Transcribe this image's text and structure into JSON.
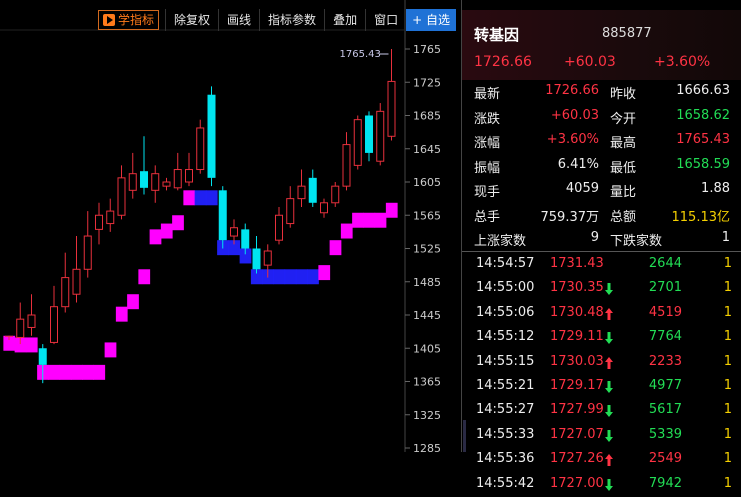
{
  "toolbar": {
    "learn": "学指标",
    "items": [
      "除复权",
      "画线",
      "指标参数",
      "叠加",
      "窗口"
    ],
    "fav": "+ 自选"
  },
  "chart_data": {
    "type": "candlestick",
    "y_axis_labels": [
      "1765",
      "1725",
      "1685",
      "1645",
      "1605",
      "1565",
      "1525",
      "1485",
      "1445",
      "1405",
      "1365",
      "1325",
      "1285"
    ],
    "high_annotation": "1765.43",
    "ylim": [
      1285,
      1770
    ],
    "colors": {
      "up": "#e8303c",
      "down": "#00e5f0",
      "band_up": "#ff00ff",
      "band_down": "#0000ff"
    },
    "candles": [
      {
        "o": 1420,
        "c": 1420,
        "h": 1420,
        "l": 1415,
        "color": "up",
        "hollow": false
      },
      {
        "o": 1418,
        "c": 1440,
        "h": 1460,
        "l": 1410,
        "color": "up",
        "hollow": true
      },
      {
        "o": 1430,
        "c": 1445,
        "h": 1470,
        "l": 1420,
        "color": "up",
        "hollow": true
      },
      {
        "o": 1405,
        "c": 1385,
        "h": 1410,
        "l": 1363,
        "color": "down",
        "hollow": false
      },
      {
        "o": 1412,
        "c": 1455,
        "h": 1480,
        "l": 1410,
        "color": "up",
        "hollow": true
      },
      {
        "o": 1455,
        "c": 1490,
        "h": 1520,
        "l": 1448,
        "color": "up",
        "hollow": true
      },
      {
        "o": 1470,
        "c": 1500,
        "h": 1540,
        "l": 1460,
        "color": "up",
        "hollow": true
      },
      {
        "o": 1500,
        "c": 1540,
        "h": 1570,
        "l": 1490,
        "color": "up",
        "hollow": true
      },
      {
        "o": 1548,
        "c": 1565,
        "h": 1580,
        "l": 1530,
        "color": "up",
        "hollow": true
      },
      {
        "o": 1555,
        "c": 1570,
        "h": 1585,
        "l": 1545,
        "color": "up",
        "hollow": true
      },
      {
        "o": 1565,
        "c": 1610,
        "h": 1625,
        "l": 1560,
        "color": "up",
        "hollow": true
      },
      {
        "o": 1595,
        "c": 1615,
        "h": 1640,
        "l": 1585,
        "color": "up",
        "hollow": true
      },
      {
        "o": 1618,
        "c": 1598,
        "h": 1660,
        "l": 1590,
        "color": "down",
        "hollow": false
      },
      {
        "o": 1595,
        "c": 1615,
        "h": 1625,
        "l": 1580,
        "color": "up",
        "hollow": true
      },
      {
        "o": 1600,
        "c": 1605,
        "h": 1610,
        "l": 1595,
        "color": "up",
        "hollow": true
      },
      {
        "o": 1598,
        "c": 1620,
        "h": 1640,
        "l": 1595,
        "color": "up",
        "hollow": true
      },
      {
        "o": 1605,
        "c": 1620,
        "h": 1640,
        "l": 1600,
        "color": "up",
        "hollow": true
      },
      {
        "o": 1620,
        "c": 1670,
        "h": 1680,
        "l": 1615,
        "color": "up",
        "hollow": true
      },
      {
        "o": 1710,
        "c": 1610,
        "h": 1720,
        "l": 1600,
        "color": "down",
        "hollow": false
      },
      {
        "o": 1595,
        "c": 1535,
        "h": 1600,
        "l": 1525,
        "color": "down",
        "hollow": false
      },
      {
        "o": 1540,
        "c": 1550,
        "h": 1560,
        "l": 1530,
        "color": "up",
        "hollow": true
      },
      {
        "o": 1548,
        "c": 1525,
        "h": 1555,
        "l": 1518,
        "color": "down",
        "hollow": false
      },
      {
        "o": 1525,
        "c": 1500,
        "h": 1540,
        "l": 1495,
        "color": "down",
        "hollow": false
      },
      {
        "o": 1505,
        "c": 1522,
        "h": 1530,
        "l": 1490,
        "color": "up",
        "hollow": true
      },
      {
        "o": 1535,
        "c": 1565,
        "h": 1575,
        "l": 1530,
        "color": "up",
        "hollow": true
      },
      {
        "o": 1555,
        "c": 1585,
        "h": 1600,
        "l": 1550,
        "color": "up",
        "hollow": true
      },
      {
        "o": 1585,
        "c": 1600,
        "h": 1620,
        "l": 1575,
        "color": "up",
        "hollow": true
      },
      {
        "o": 1610,
        "c": 1580,
        "h": 1620,
        "l": 1575,
        "color": "down",
        "hollow": false
      },
      {
        "o": 1568,
        "c": 1580,
        "h": 1585,
        "l": 1562,
        "color": "up",
        "hollow": true
      },
      {
        "o": 1580,
        "c": 1600,
        "h": 1605,
        "l": 1575,
        "color": "up",
        "hollow": true
      },
      {
        "o": 1600,
        "c": 1650,
        "h": 1665,
        "l": 1595,
        "color": "up",
        "hollow": true
      },
      {
        "o": 1625,
        "c": 1680,
        "h": 1685,
        "l": 1620,
        "color": "up",
        "hollow": true
      },
      {
        "o": 1685,
        "c": 1640,
        "h": 1690,
        "l": 1630,
        "color": "down",
        "hollow": false
      },
      {
        "o": 1630,
        "c": 1690,
        "h": 1700,
        "l": 1625,
        "color": "up",
        "hollow": true
      },
      {
        "o": 1660,
        "c": 1726,
        "h": 1765,
        "l": 1655,
        "color": "up",
        "hollow": true
      }
    ]
  },
  "header": {
    "name": "转基因",
    "code": "885877",
    "price": "1726.66",
    "change": "+60.03",
    "pct": "+3.60%"
  },
  "quote": {
    "rows": [
      {
        "l1": "最新",
        "v1": "1726.66",
        "c1": "red",
        "l2": "昨收",
        "v2": "1666.63",
        "c2": "white"
      },
      {
        "l1": "涨跌",
        "v1": "+60.03",
        "c1": "red",
        "l2": "今开",
        "v2": "1658.62",
        "c2": "green"
      },
      {
        "l1": "涨幅",
        "v1": "+3.60%",
        "c1": "red",
        "l2": "最高",
        "v2": "1765.43",
        "c2": "red"
      },
      {
        "l1": "振幅",
        "v1": "6.41%",
        "c1": "white",
        "l2": "最低",
        "v2": "1658.59",
        "c2": "green"
      },
      {
        "l1": "现手",
        "v1": "4059",
        "c1": "white",
        "l2": "量比",
        "v2": "1.88",
        "c2": "white"
      },
      {
        "l1": "总手",
        "v1": "759.37万",
        "c1": "white",
        "l2": "总额",
        "v2": "115.13亿",
        "c2": "yellow"
      },
      {
        "l1": "上涨家数",
        "v1": "9",
        "c1": "white",
        "l2": "下跌家数",
        "v2": "1",
        "c2": "white"
      }
    ]
  },
  "ticks": [
    {
      "time": "14:54:57",
      "price": "1731.43",
      "dir": "none",
      "vol": "2644",
      "vc": "green",
      "n": "1"
    },
    {
      "time": "14:55:00",
      "price": "1730.35",
      "dir": "down",
      "vol": "2701",
      "vc": "green",
      "n": "1"
    },
    {
      "time": "14:55:06",
      "price": "1730.48",
      "dir": "up",
      "vol": "4519",
      "vc": "red",
      "n": "1"
    },
    {
      "time": "14:55:12",
      "price": "1729.11",
      "dir": "down",
      "vol": "7764",
      "vc": "green",
      "n": "1"
    },
    {
      "time": "14:55:15",
      "price": "1730.03",
      "dir": "up",
      "vol": "2233",
      "vc": "red",
      "n": "1"
    },
    {
      "time": "14:55:21",
      "price": "1729.17",
      "dir": "down",
      "vol": "4977",
      "vc": "green",
      "n": "1"
    },
    {
      "time": "14:55:27",
      "price": "1727.99",
      "dir": "down",
      "vol": "5617",
      "vc": "green",
      "n": "1"
    },
    {
      "time": "14:55:33",
      "price": "1727.07",
      "dir": "down",
      "vol": "5339",
      "vc": "green",
      "n": "1"
    },
    {
      "time": "14:55:36",
      "price": "1727.26",
      "dir": "up",
      "vol": "2549",
      "vc": "red",
      "n": "1"
    },
    {
      "time": "14:55:42",
      "price": "1727.00",
      "dir": "down",
      "vol": "7942",
      "vc": "green",
      "n": "1"
    }
  ]
}
